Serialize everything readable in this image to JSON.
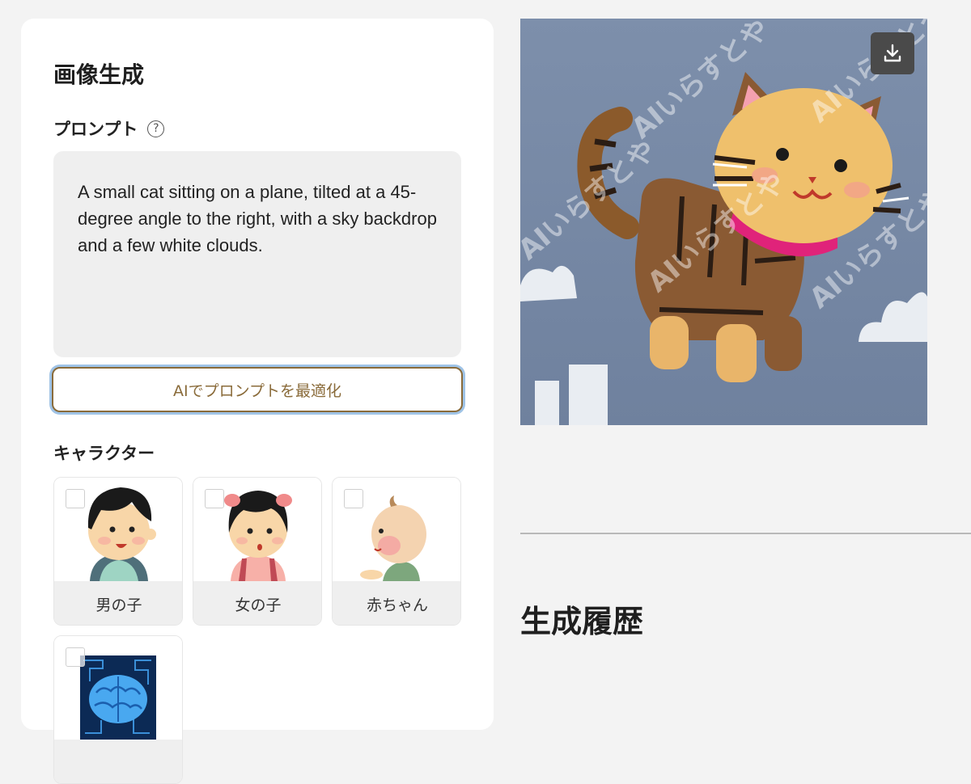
{
  "panel": {
    "title": "画像生成",
    "prompt_label": "プロンプト",
    "help_symbol": "?",
    "prompt_text": "A small cat sitting on a plane, tilted at a 45-degree angle to the right, with a sky backdrop and a few white clouds.",
    "optimize_button": "AIでプロンプトを最適化",
    "character_label": "キャラクター",
    "characters": [
      {
        "name": "男の子",
        "selected": false
      },
      {
        "name": "女の子",
        "selected": false
      },
      {
        "name": "赤ちゃん",
        "selected": false
      },
      {
        "name": "",
        "selected": false
      }
    ]
  },
  "preview": {
    "watermark": "AIいらすとや",
    "download_icon": "download-icon"
  },
  "history": {
    "title": "生成履歴"
  },
  "colors": {
    "accent_brown": "#8a6b3a",
    "focus_ring": "#9fc3e6",
    "background": "#f3f3f3"
  }
}
